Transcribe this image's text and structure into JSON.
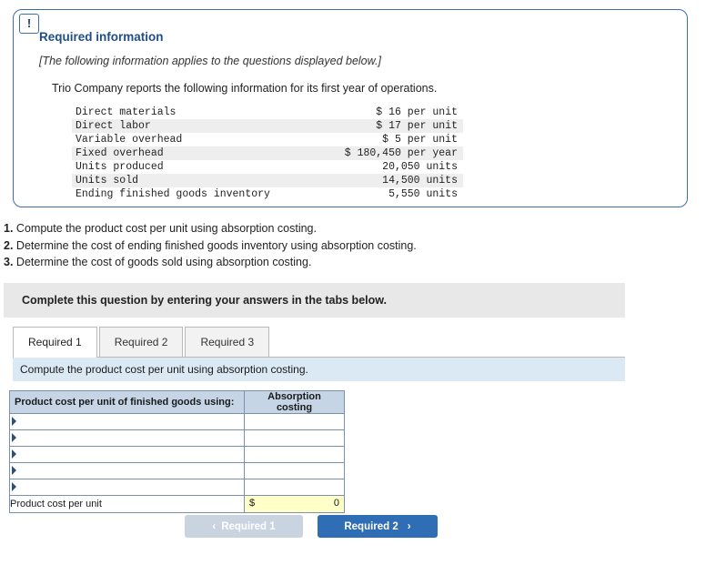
{
  "card": {
    "badge": "!",
    "title": "Required information",
    "subtitle": "[The following information applies to the questions displayed below.]",
    "intro": "Trio Company reports the following information for its first year of operations.",
    "rows": [
      {
        "label": "Direct materials",
        "value": "$ 16 per unit"
      },
      {
        "label": "Direct labor",
        "value": "$ 17 per unit"
      },
      {
        "label": "Variable overhead",
        "value": "$ 5 per unit"
      },
      {
        "label": "Fixed overhead",
        "value": "$ 180,450 per year"
      },
      {
        "label": "Units produced",
        "value": "20,050 units"
      },
      {
        "label": "Units sold",
        "value": "14,500 units"
      },
      {
        "label": "Ending finished goods inventory",
        "value": "5,550 units"
      }
    ]
  },
  "requirements": [
    {
      "num": "1.",
      "text": "Compute the product cost per unit using absorption costing."
    },
    {
      "num": "2.",
      "text": "Determine the cost of ending finished goods inventory using absorption costing."
    },
    {
      "num": "3.",
      "text": "Determine the cost of goods sold using absorption costing."
    }
  ],
  "instruction_bar": "Complete this question by entering your answers in the tabs below.",
  "tabs": [
    {
      "label": "Required 1",
      "active": true
    },
    {
      "label": "Required 2",
      "active": false
    },
    {
      "label": "Required 3",
      "active": false
    }
  ],
  "prompt": "Compute the product cost per unit using absorption costing.",
  "answer_table": {
    "header_left": "Product cost per unit of finished goods using:",
    "header_right": "Absorption costing",
    "blank_rows": 5,
    "total_label": "Product cost per unit",
    "total_currency": "$",
    "total_value": "0"
  },
  "nav": {
    "prev_label": "Required 1",
    "prev_chevron": "‹",
    "next_label": "Required 2",
    "next_chevron": "›"
  }
}
